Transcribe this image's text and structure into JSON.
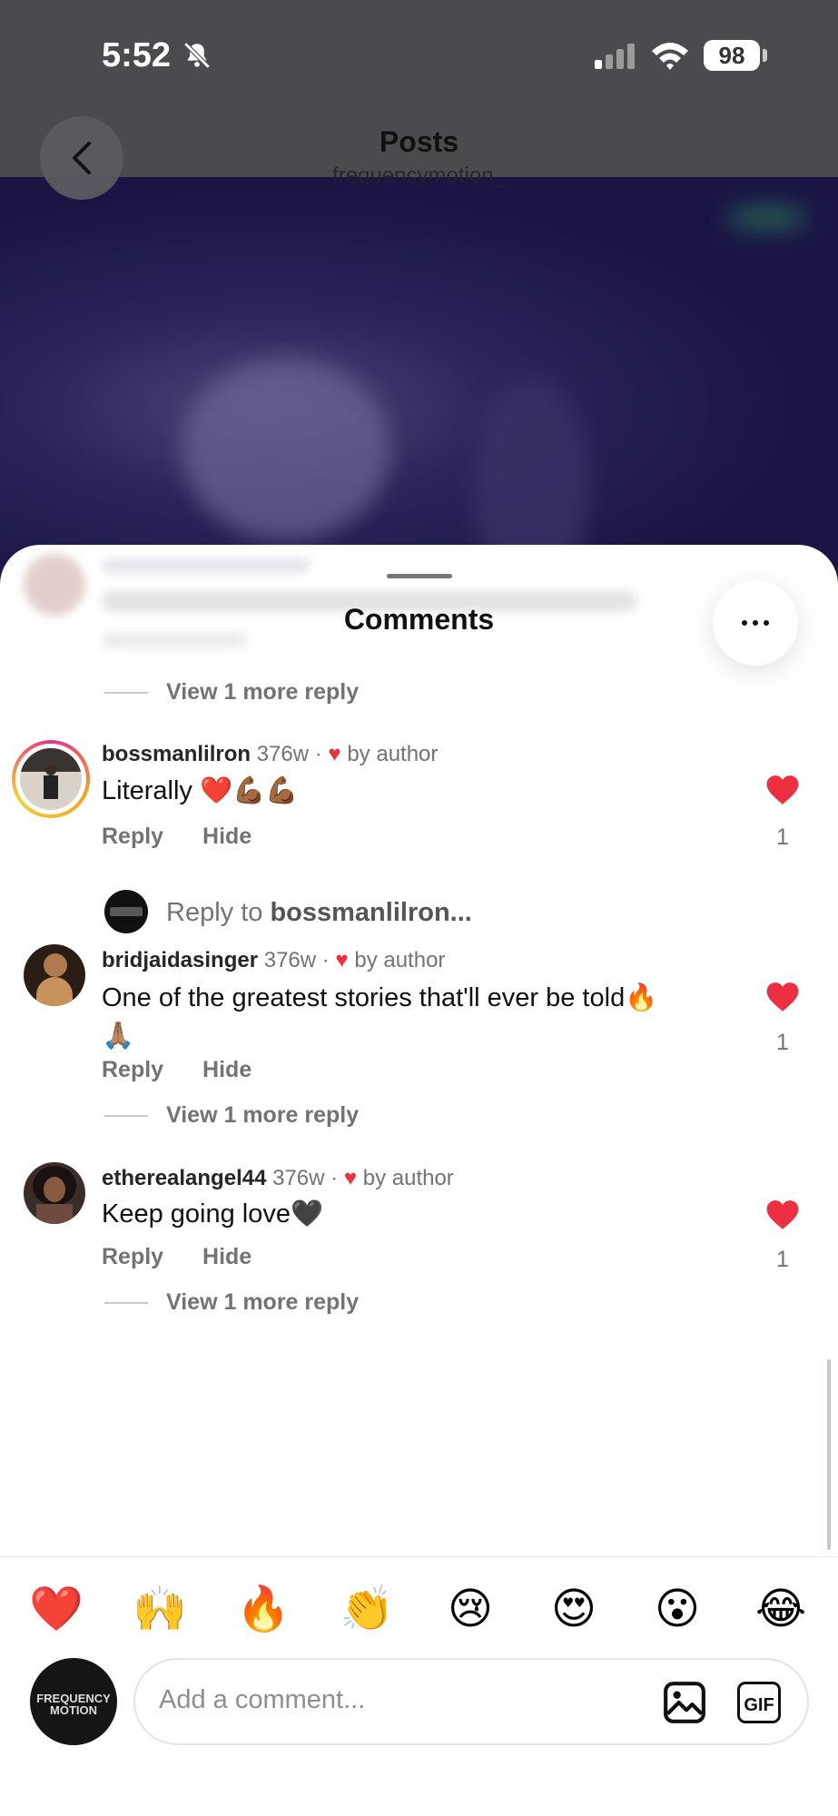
{
  "status_bar": {
    "time": "5:52",
    "battery": "98"
  },
  "header": {
    "title": "Posts",
    "subtitle": "frequencymotion_"
  },
  "sheet": {
    "title": "Comments",
    "top_view_more": "View 1 more reply",
    "comments": [
      {
        "username": "bossmanlilron",
        "age": "376w",
        "liked_by": "by author",
        "text": "Literally ❤️💪🏾💪🏾",
        "reply_label": "Reply",
        "hide_label": "Hide",
        "likes": "1",
        "reply_to_prefix": "Reply to ",
        "reply_to_user": "bossmanlilron..."
      },
      {
        "username": "bridjaidasinger",
        "age": "376w",
        "liked_by": "by author",
        "text_line1": "One of the greatest stories that'll ever be told🔥",
        "text_line2": "🙏🏽",
        "reply_label": "Reply",
        "hide_label": "Hide",
        "likes": "1",
        "view_more": "View 1 more reply"
      },
      {
        "username": "etherealangel44",
        "age": "376w",
        "liked_by": "by author",
        "text": "Keep going love🖤",
        "reply_label": "Reply",
        "hide_label": "Hide",
        "likes": "1",
        "view_more": "View 1 more reply"
      }
    ]
  },
  "quick_reactions": [
    "❤️",
    "🙌",
    "🔥",
    "👏",
    "😢",
    "😍",
    "😮",
    "😂"
  ],
  "composer": {
    "placeholder": "Add a comment...",
    "gif_label": "GIF",
    "avatar_text_line1": "FREQUENCY",
    "avatar_text_line2": "MOTION"
  },
  "colors": {
    "like_red": "#ed2f42",
    "muted_text": "#737373"
  },
  "icons": [
    "back-arrow-icon",
    "more-icon",
    "heart-icon",
    "image-icon",
    "gif-icon",
    "bell-slash-icon",
    "signal-icon",
    "wifi-icon",
    "battery-icon"
  ]
}
